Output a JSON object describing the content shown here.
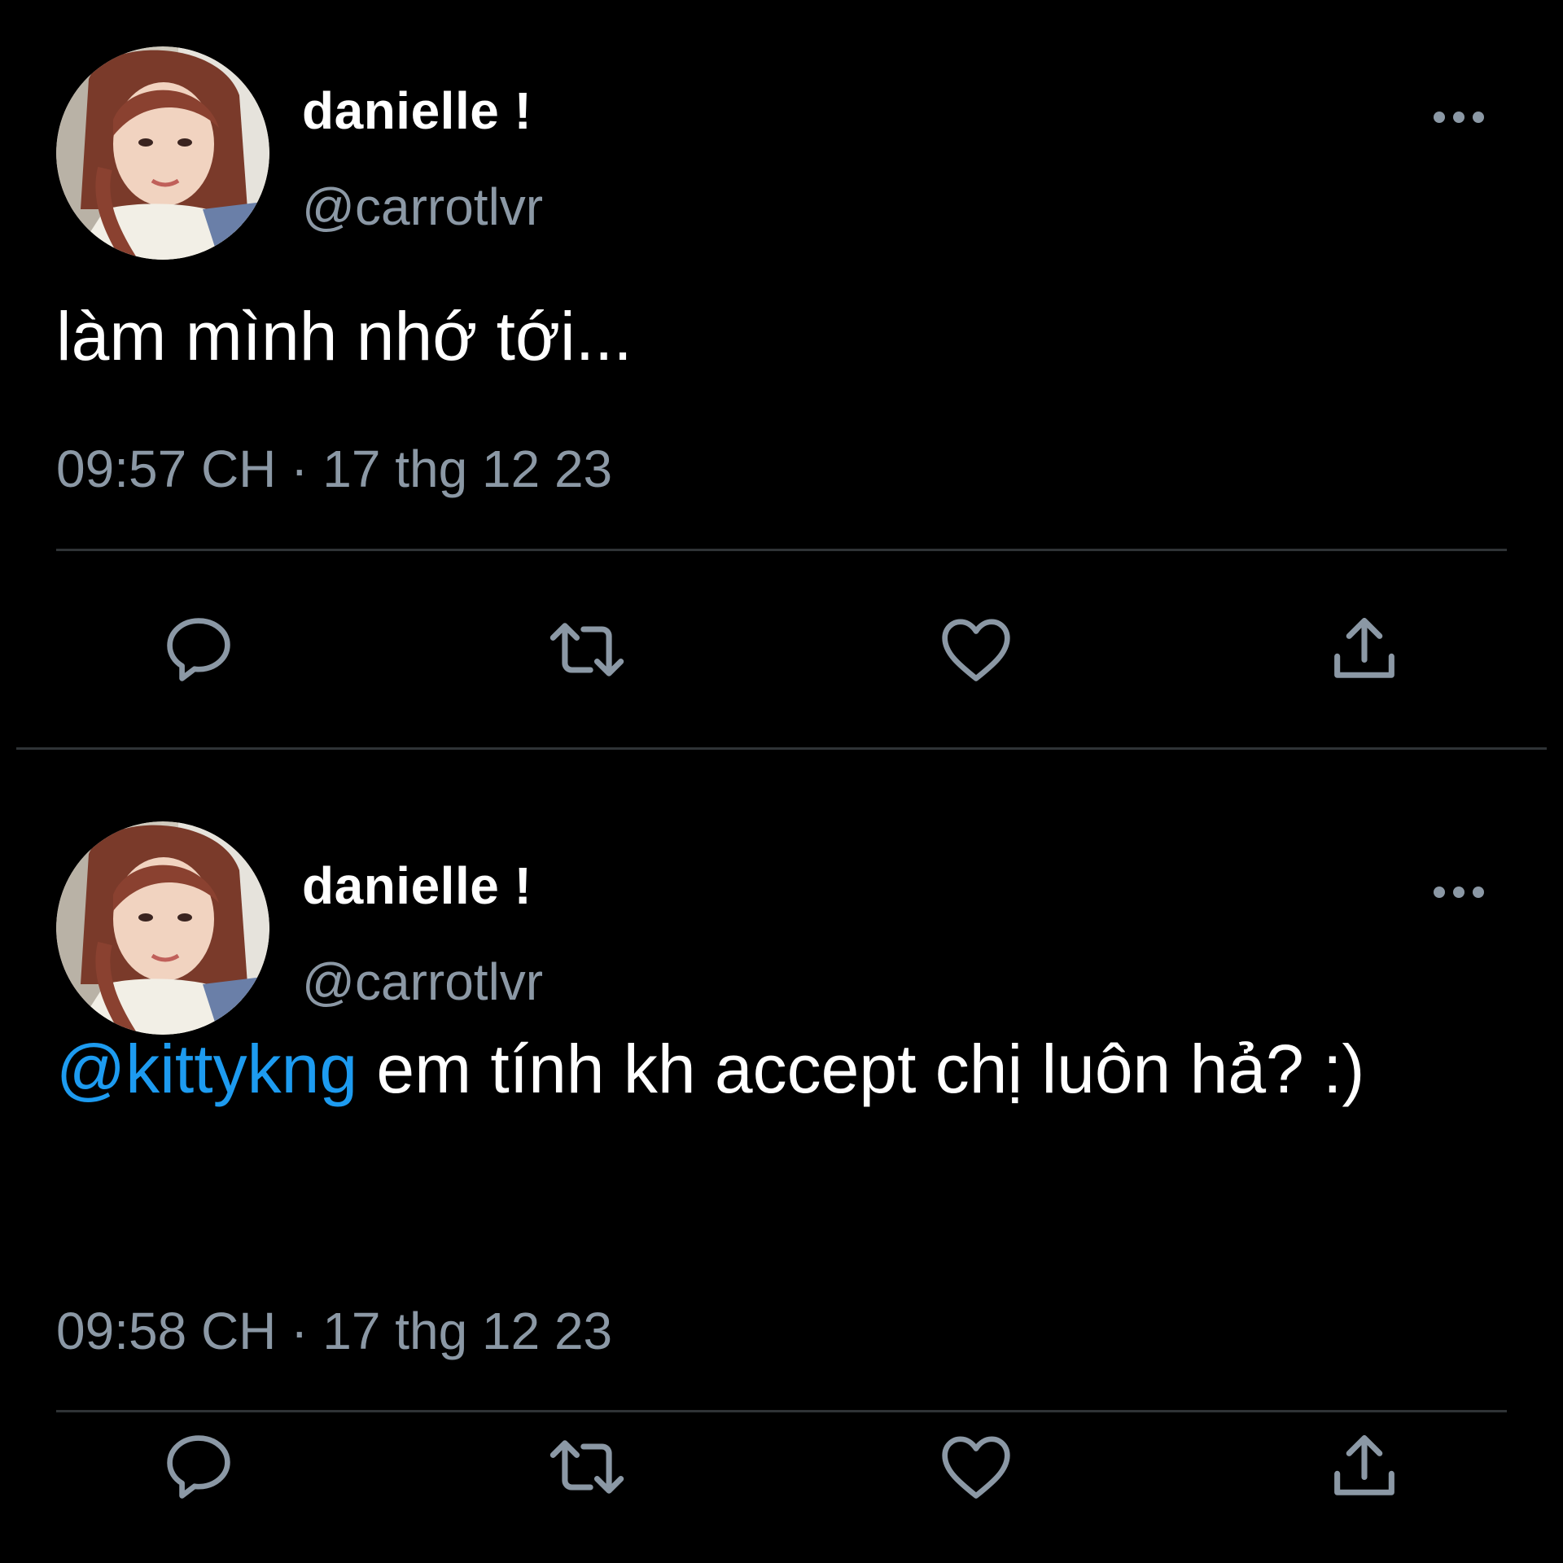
{
  "tweets": [
    {
      "display_name": "danielle !",
      "handle": "@carrotlvr",
      "text": "làm mình nhớ tới...",
      "mention": "",
      "time": "09:57 CH",
      "separator": "·",
      "date": "17 thg 12 23"
    },
    {
      "display_name": "danielle !",
      "handle": "@carrotlvr",
      "mention": "@kittykng",
      "text": " em tính kh accept chị luôn hả? :)",
      "time": "09:58 CH",
      "separator": "·",
      "date": "17 thg 12 23"
    }
  ],
  "icons": {
    "more": "more-horizontal-icon",
    "reply": "reply-icon",
    "retweet": "retweet-icon",
    "like": "heart-icon",
    "share": "share-icon"
  },
  "colors": {
    "background": "#000000",
    "text": "#ffffff",
    "secondary": "#8b98a5",
    "mention": "#1d9bf0",
    "divider": "#2f3336",
    "icon": "#8b98a5"
  }
}
